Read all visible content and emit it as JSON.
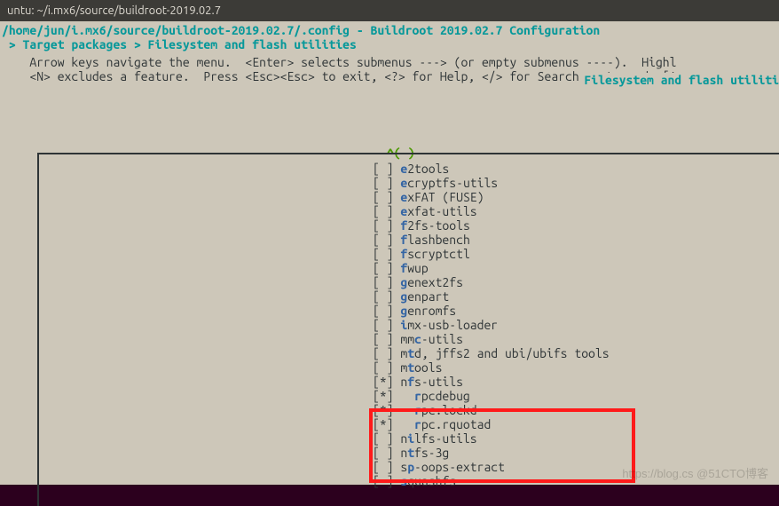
{
  "window": {
    "title": "untu: ~/i.mx6/source/buildroot-2019.02.7"
  },
  "header": {
    "path_line": "/home/jun/i.mx6/source/buildroot-2019.02.7/.config - Buildroot 2019.02.7 Configuration",
    "breadcrumb": " > Target packages > Filesystem and flash utilities ",
    "section": " Filesystem and flash utiliti"
  },
  "help": {
    "line1": "    Arrow keys navigate the menu.  <Enter> selects submenus ---> (or empty submenus ----).  Highl",
    "line2": "    <N> excludes a feature.  Press <Esc><Esc> to exit, <?> for Help, </> for Search.   Legend: [*"
  },
  "scroll_indicator": "^(-)",
  "options": [
    {
      "sel": " ",
      "pre": "",
      "hl": "e",
      "rest": "2tools"
    },
    {
      "sel": " ",
      "pre": "",
      "hl": "e",
      "rest": "cryptfs-utils"
    },
    {
      "sel": " ",
      "pre": "",
      "hl": "e",
      "rest": "xFAT (FUSE)"
    },
    {
      "sel": " ",
      "pre": "",
      "hl": "e",
      "rest": "xfat-utils"
    },
    {
      "sel": " ",
      "pre": "",
      "hl": "f",
      "rest": "2fs-tools"
    },
    {
      "sel": " ",
      "pre": "",
      "hl": "f",
      "rest": "lashbench"
    },
    {
      "sel": " ",
      "pre": "",
      "hl": "f",
      "rest": "scryptctl"
    },
    {
      "sel": " ",
      "pre": "",
      "hl": "f",
      "rest": "wup"
    },
    {
      "sel": " ",
      "pre": "",
      "hl": "g",
      "rest": "enext2fs"
    },
    {
      "sel": " ",
      "pre": "",
      "hl": "g",
      "rest": "enpart"
    },
    {
      "sel": " ",
      "pre": "",
      "hl": "g",
      "rest": "enromfs"
    },
    {
      "sel": " ",
      "pre": "",
      "hl": "i",
      "rest": "mx-usb-loader"
    },
    {
      "sel": " ",
      "pre": "mm",
      "hl": "c",
      "rest": "-utils"
    },
    {
      "sel": " ",
      "pre": "m",
      "hl": "t",
      "rest": "d, jffs2 and ubi/ubifs tools"
    },
    {
      "sel": " ",
      "pre": "m",
      "hl": "t",
      "rest": "ools"
    },
    {
      "sel": "*",
      "pre": "n",
      "hl": "f",
      "rest": "s-utils"
    },
    {
      "sel": "*",
      "pre": "  ",
      "hl": "r",
      "rest": "pcdebug"
    },
    {
      "sel": "*",
      "pre": "  ",
      "hl": "r",
      "rest": "pc.lockd"
    },
    {
      "sel": "*",
      "pre": "  ",
      "hl": "r",
      "rest": "pc.rquotad"
    },
    {
      "sel": " ",
      "pre": "n",
      "hl": "i",
      "rest": "lfs-utils"
    },
    {
      "sel": " ",
      "pre": "n",
      "hl": "t",
      "rest": "fs-3g"
    },
    {
      "sel": " ",
      "pre": "s",
      "hl": "p",
      "rest": "-oops-extract"
    },
    {
      "sel": " ",
      "pre": "",
      "hl": "s",
      "rest": "quashfs"
    }
  ],
  "watermark": "https://blog.cs @51CTO博客"
}
